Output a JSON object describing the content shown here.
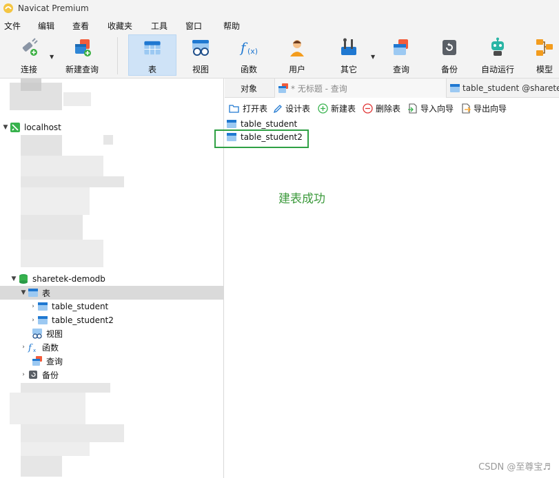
{
  "window": {
    "title": "Navicat Premium"
  },
  "menu": [
    "文件",
    "编辑",
    "查看",
    "收藏夹",
    "工具",
    "窗口",
    "帮助"
  ],
  "toolbar": {
    "items": [
      {
        "label": "连接",
        "icon": "plug-icon"
      },
      {
        "label": "新建查询",
        "icon": "new-query-icon"
      },
      {
        "label": "表",
        "icon": "table-icon"
      },
      {
        "label": "视图",
        "icon": "view-icon"
      },
      {
        "label": "函数",
        "icon": "function-icon"
      },
      {
        "label": "用户",
        "icon": "user-icon"
      },
      {
        "label": "其它",
        "icon": "tools-icon"
      },
      {
        "label": "查询",
        "icon": "query-icon"
      },
      {
        "label": "备份",
        "icon": "backup-icon"
      },
      {
        "label": "自动运行",
        "icon": "robot-icon"
      },
      {
        "label": "模型",
        "icon": "model-icon"
      }
    ],
    "active": "表"
  },
  "sidebar": {
    "connection": "localhost",
    "database": "sharetek-demodb",
    "tables_node": "表",
    "tables": [
      "table_student",
      "table_student2"
    ],
    "views_node": "视图",
    "functions_node": "函数",
    "queries_node": "查询",
    "backups_node": "备份"
  },
  "tabs": {
    "objects": "对象",
    "query_tab": "* 无标题 - 查询",
    "table_tab": "table_student @sharetek"
  },
  "object_toolbar": {
    "open": "打开表",
    "design": "设计表",
    "new": "新建表",
    "delete": "删除表",
    "import": "导入向导",
    "export": "导出向导"
  },
  "object_list": [
    "table_student",
    "table_student2"
  ],
  "annotation": "建表成功",
  "watermark": "CSDN @至尊宝♬",
  "colors": {
    "accent_green": "#2ea043",
    "annotation_green": "#3c9a3c",
    "selected_bg": "#cfe3f7"
  }
}
